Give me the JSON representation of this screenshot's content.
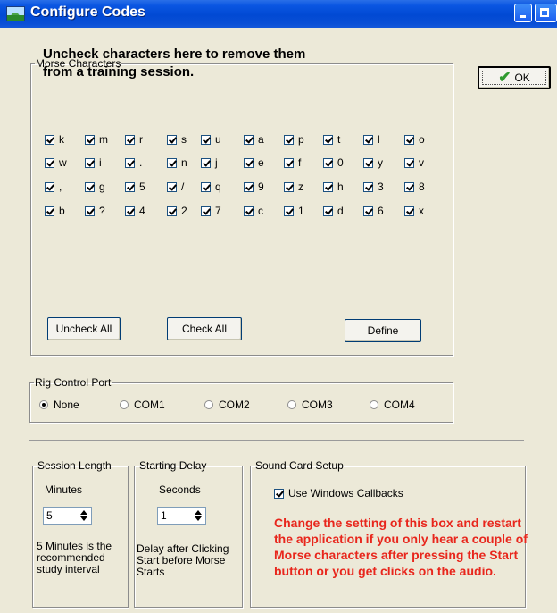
{
  "window": {
    "title": "Configure Codes"
  },
  "morse": {
    "legend": "Morse Characters",
    "instructions_line1": "Uncheck characters here to remove them",
    "instructions_line2": "from a training session.",
    "rows": [
      [
        "k",
        "m",
        "r",
        "s",
        "u",
        "a",
        "p",
        "t",
        "l",
        "o"
      ],
      [
        "w",
        "i",
        ".",
        "n",
        "j",
        "e",
        "f",
        "0",
        "y",
        "v"
      ],
      [
        ",",
        "g",
        "5",
        "/",
        "q",
        "9",
        "z",
        "h",
        "3",
        "8"
      ],
      [
        "b",
        "?",
        "4",
        "2",
        "7",
        "c",
        "1",
        "d",
        "6",
        "x"
      ]
    ],
    "uncheck_all": "Uncheck All",
    "check_all": "Check All",
    "define": "Define"
  },
  "ok_label": "OK",
  "rig": {
    "legend": "Rig Control Port",
    "options": [
      "None",
      "COM1",
      "COM2",
      "COM3",
      "COM4"
    ]
  },
  "session": {
    "legend": "Session Length",
    "unit": "Minutes",
    "value": "5",
    "note": [
      "5 Minutes is the",
      "recommended",
      "study interval"
    ]
  },
  "delay": {
    "legend": "Starting Delay",
    "unit": "Seconds",
    "value": "1",
    "note": [
      "Delay after Clicking",
      "Start before Morse",
      "Starts"
    ]
  },
  "sound": {
    "legend": "Sound Card Setup",
    "callbacks_label": "Use Windows Callbacks",
    "warning": "Change the setting of this box and restart the application if you only hear a couple of Morse characters after pressing the Start button or you get clicks on the audio."
  },
  "colors": {
    "title_bar": "#0a56e2",
    "warning": "#e8261c",
    "ok_check": "#2f9a2f"
  }
}
